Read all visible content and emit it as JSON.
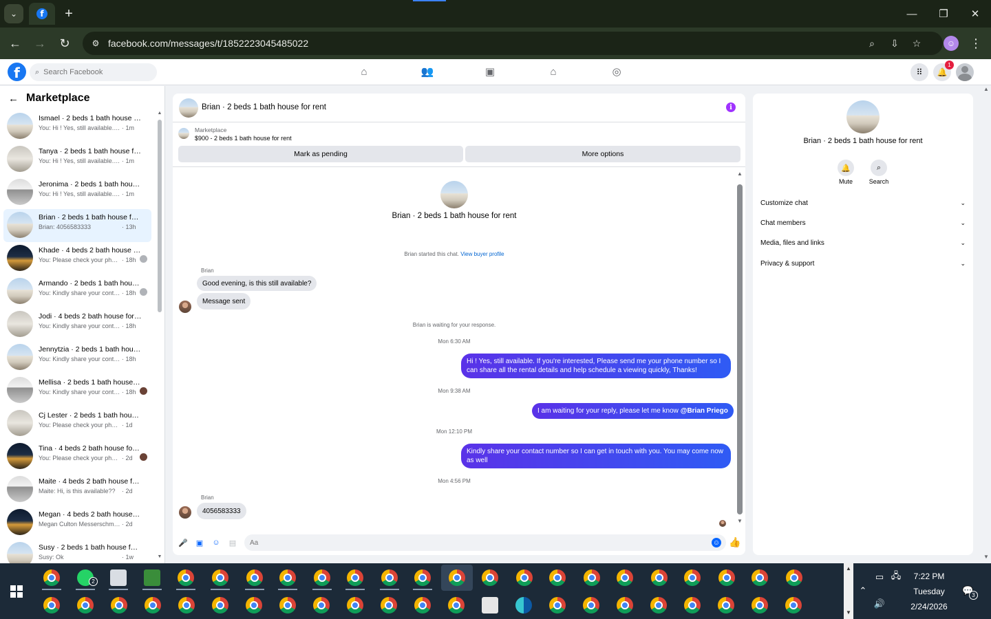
{
  "browser": {
    "url": "facebook.com/messages/t/1852223045485022",
    "new_tab": "+",
    "tab_dropdown": "⌄",
    "window_controls": {
      "minimize": "—",
      "restore": "❐",
      "close": "✕"
    }
  },
  "fb": {
    "search_placeholder": "Search Facebook",
    "notification_count": "1"
  },
  "left": {
    "title": "Marketplace",
    "conversations": [
      {
        "name": "Ismael · 2 beds 1 bath house for rent",
        "snippet": "You: Hi ! Yes, still available. If you're interested",
        "time": "· 1m",
        "thumb": "img-house"
      },
      {
        "name": "Tanya · 2 beds 1 bath house for rent",
        "snippet": "You: Hi ! Yes, still available. If you're interested",
        "time": "· 1m",
        "thumb": "img-room"
      },
      {
        "name": "Jeronima · 2 beds 1 bath house for rent",
        "snippet": "You: Hi ! Yes, still available. If you're interested",
        "time": "· 1m",
        "thumb": "img-house2"
      },
      {
        "name": "Brian · 2 beds 1 bath house for rent",
        "snippet": "Brian: 4056583333",
        "time": "· 13h",
        "thumb": "img-house",
        "active": true
      },
      {
        "name": "Khade · 4 beds 2 bath house for rent",
        "snippet": "You: Please check your phone, I sent",
        "time": "· 18h",
        "thumb": "img-night",
        "seen": "img-gray"
      },
      {
        "name": "Armando · 2 beds 1 bath house for rent",
        "snippet": "You: Kindly share your contact number",
        "time": "· 18h",
        "thumb": "img-house",
        "seen": "img-gray"
      },
      {
        "name": "Jodi · 4 beds 2 bath house for rent",
        "snippet": "You: Kindly share your contact number",
        "time": "· 18h",
        "thumb": "img-room"
      },
      {
        "name": "Jennytzia · 2 beds 1 bath house for rent",
        "snippet": "You: Kindly share your contact number",
        "time": "· 18h",
        "thumb": "img-house"
      },
      {
        "name": "Mellisa · 2 beds 1 bath house for rent",
        "snippet": "You: Kindly share your contact number",
        "time": "· 18h",
        "thumb": "img-house2",
        "seen": "img-dark"
      },
      {
        "name": "Cj Lester · 2 beds 1 bath house for rent",
        "snippet": "You: Please check your phone, I have",
        "time": "· 1d",
        "thumb": "img-room"
      },
      {
        "name": "Tina · 4 beds 2 bath house for rent",
        "snippet": "You: Please check your phone, I sent",
        "time": "· 2d",
        "thumb": "img-night",
        "seen": "img-dark"
      },
      {
        "name": "Maite · 4 beds 2 bath house for rent",
        "snippet": "Maite: Hi, is this available??",
        "time": "· 2d",
        "thumb": "img-house2"
      },
      {
        "name": "Megan · 4 beds 2 bath house for rent",
        "snippet": "Megan Culton Messerschmidt left the group",
        "time": "· 2d",
        "thumb": "img-night"
      },
      {
        "name": "Susy · 2 beds 1 bath house for rent",
        "snippet": "Susy: Ok",
        "time": "· 1w",
        "thumb": "img-house"
      }
    ]
  },
  "chat": {
    "title": "Brian · 2 beds 1 bath house for rent",
    "marketplace_label": "Marketplace",
    "listing": "$900 - 2 beds 1 bath house for rent",
    "mark_pending": "Mark as pending",
    "more_options": "More options",
    "header_name": "Brian · 2 beds 1 bath house for rent",
    "started": "Brian started this chat.",
    "view_profile": "View buyer profile",
    "sender1": "Brian",
    "msg1": "Good evening, is this still available?",
    "msg2": "Message sent",
    "waiting": "Brian is waiting for your response.",
    "time1": "Mon 6:30 AM",
    "out1": "Hi ! Yes, still available. If you're interested, Please send me your phone number so I can share all the rental details and help schedule a viewing quickly, Thanks!",
    "time2": "Mon 9:38 AM",
    "out2_text": "I am waiting for your reply, please let me know ",
    "out2_mention": "@Brian Priego",
    "time3": "Mon 12:10 PM",
    "out3": "Kindly share your contact number so I can get in touch with you. You may come now as well",
    "time4": "Mon 4:56 PM",
    "sender2": "Brian",
    "msg3": "4056583333",
    "composer_placeholder": "Aa"
  },
  "right": {
    "name": "Brian · 2 beds 1 bath house for rent",
    "mute": "Mute",
    "search": "Search",
    "sections": [
      "Customize chat",
      "Chat members",
      "Media, files and links",
      "Privacy & support"
    ]
  },
  "taskbar": {
    "whatsapp_badge": "2",
    "time": "7:22 PM",
    "day": "Tuesday",
    "date": "2/24/2026",
    "notifications": "3"
  },
  "colors": {
    "fb_blue": "#1877f2",
    "bubble_out_start": "#5a32e8",
    "bubble_out_end": "#2f5bf4",
    "chrome_bg": "#1b2417",
    "taskbar_bg": "#1c2a38"
  }
}
